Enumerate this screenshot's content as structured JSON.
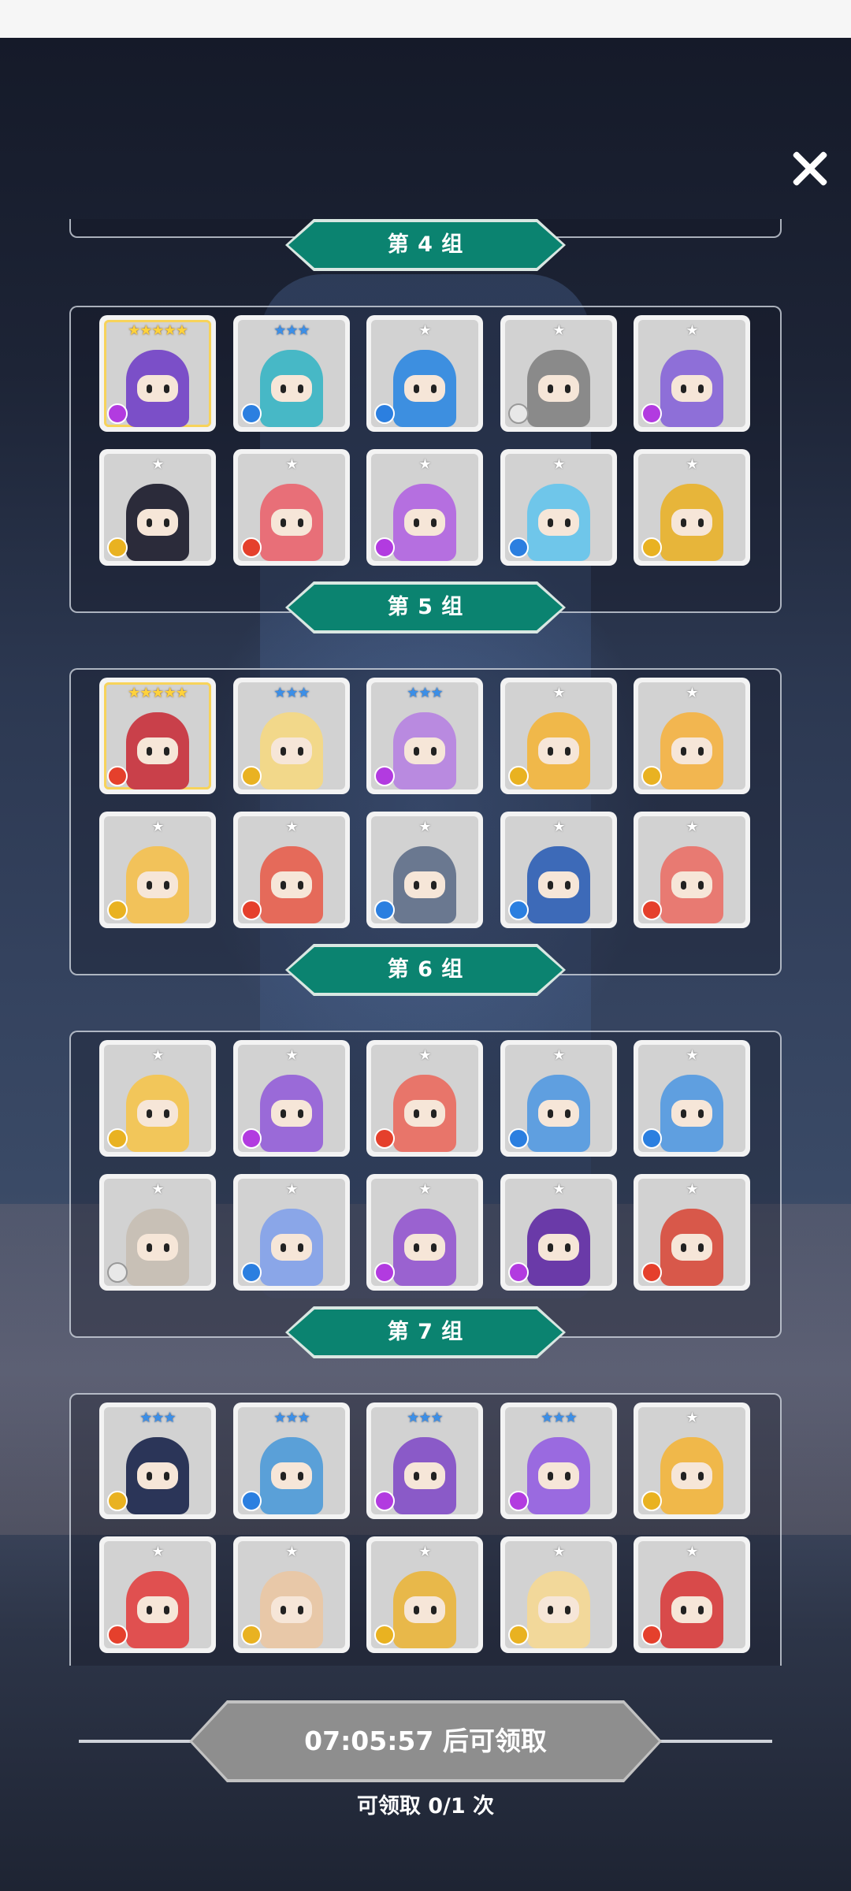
{
  "groups": [
    {
      "label": "第 4 组",
      "cards": [
        {
          "stars": "★★★★★",
          "tier": "gold",
          "element": "moon",
          "color": "#7b4fc8"
        },
        {
          "stars": "★★★",
          "tier": "blue",
          "element": "water",
          "color": "#47b8c6"
        },
        {
          "stars": "★",
          "tier": "grey",
          "element": "water",
          "color": "#3d8fe0"
        },
        {
          "stars": "★",
          "tier": "grey",
          "element": "light",
          "color": "#8a8a8a"
        },
        {
          "stars": "★",
          "tier": "grey",
          "element": "moon",
          "color": "#8e6fd8"
        },
        {
          "stars": "★",
          "tier": "grey",
          "element": "wind",
          "color": "#2b2b3a"
        },
        {
          "stars": "★",
          "tier": "grey",
          "element": "fire",
          "color": "#e86f78"
        },
        {
          "stars": "★",
          "tier": "grey",
          "element": "moon",
          "color": "#b56fe0"
        },
        {
          "stars": "★",
          "tier": "grey",
          "element": "water",
          "color": "#6fc6ea"
        },
        {
          "stars": "★",
          "tier": "grey",
          "element": "wind",
          "color": "#e7b53a"
        }
      ]
    },
    {
      "label": "第 5 组",
      "cards": [
        {
          "stars": "★★★★★",
          "tier": "gold",
          "element": "fire",
          "color": "#c9404a"
        },
        {
          "stars": "★★★",
          "tier": "blue",
          "element": "wind",
          "color": "#f2d88a"
        },
        {
          "stars": "★★★",
          "tier": "blue",
          "element": "moon",
          "color": "#b98ae0"
        },
        {
          "stars": "★",
          "tier": "grey",
          "element": "wind",
          "color": "#f0b84a"
        },
        {
          "stars": "★",
          "tier": "grey",
          "element": "wind",
          "color": "#f2b650"
        },
        {
          "stars": "★",
          "tier": "grey",
          "element": "wind",
          "color": "#f2c25a"
        },
        {
          "stars": "★",
          "tier": "grey",
          "element": "fire",
          "color": "#e56a5a"
        },
        {
          "stars": "★",
          "tier": "grey",
          "element": "water",
          "color": "#6a7890"
        },
        {
          "stars": "★",
          "tier": "grey",
          "element": "water",
          "color": "#3d6ab8"
        },
        {
          "stars": "★",
          "tier": "grey",
          "element": "fire",
          "color": "#e87a72"
        }
      ]
    },
    {
      "label": "第 6 组",
      "cards": [
        {
          "stars": "★",
          "tier": "grey",
          "element": "wind",
          "color": "#f2c65a"
        },
        {
          "stars": "★",
          "tier": "grey",
          "element": "moon",
          "color": "#9a6ad8"
        },
        {
          "stars": "★",
          "tier": "grey",
          "element": "fire",
          "color": "#e8756a"
        },
        {
          "stars": "★",
          "tier": "grey",
          "element": "water",
          "color": "#5f9fe0"
        },
        {
          "stars": "★",
          "tier": "grey",
          "element": "water",
          "color": "#5f9fe0"
        },
        {
          "stars": "★",
          "tier": "grey",
          "element": "light",
          "color": "#c8c0b6"
        },
        {
          "stars": "★",
          "tier": "grey",
          "element": "water",
          "color": "#8aa6e8"
        },
        {
          "stars": "★",
          "tier": "grey",
          "element": "moon",
          "color": "#9a62d0"
        },
        {
          "stars": "★",
          "tier": "grey",
          "element": "moon",
          "color": "#6a3aa8"
        },
        {
          "stars": "★",
          "tier": "grey",
          "element": "fire",
          "color": "#d8584a"
        }
      ]
    },
    {
      "label": "第 7 组",
      "cards": [
        {
          "stars": "★★★",
          "tier": "blue",
          "element": "wind",
          "color": "#2b3558"
        },
        {
          "stars": "★★★",
          "tier": "blue",
          "element": "water",
          "color": "#5aa0d8"
        },
        {
          "stars": "★★★",
          "tier": "blue",
          "element": "moon",
          "color": "#8a5ac8"
        },
        {
          "stars": "★★★",
          "tier": "blue",
          "element": "moon",
          "color": "#9a6ae0"
        },
        {
          "stars": "★",
          "tier": "grey",
          "element": "wind",
          "color": "#f0b84a"
        },
        {
          "stars": "★",
          "tier": "grey",
          "element": "fire",
          "color": "#e05050"
        },
        {
          "stars": "★",
          "tier": "grey",
          "element": "wind",
          "color": "#e8c8a8"
        },
        {
          "stars": "★",
          "tier": "grey",
          "element": "wind",
          "color": "#e8b84a"
        },
        {
          "stars": "★",
          "tier": "grey",
          "element": "wind",
          "color": "#f2d89a"
        },
        {
          "stars": "★",
          "tier": "grey",
          "element": "fire",
          "color": "#d84a4a"
        }
      ]
    }
  ],
  "claim_button": "07:05:57 后可领取",
  "claim_count": "可领取 0/1 次"
}
